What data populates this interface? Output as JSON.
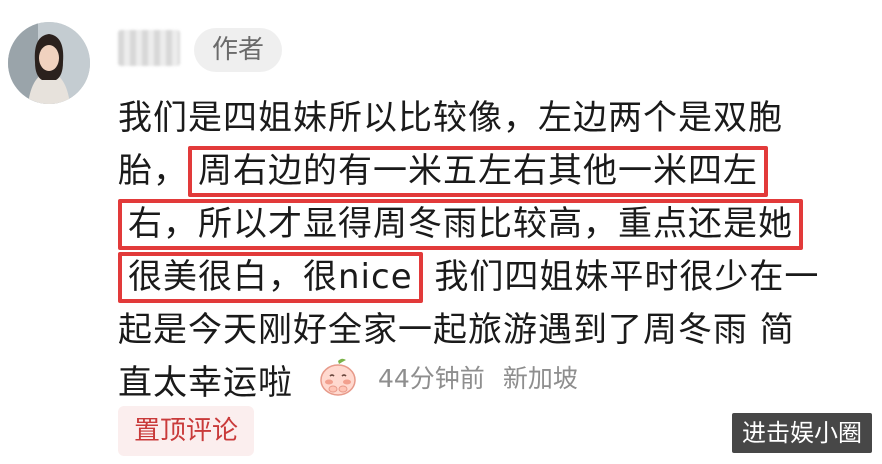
{
  "comment": {
    "author_badge": "作者",
    "lines": [
      {
        "pre": "我们是四姐妹所以比较像，左边两个是双胞",
        "hl": "",
        "post": ""
      },
      {
        "pre": "胎，",
        "hl": "周右边的有一米五左右其他一米四左",
        "post": ""
      },
      {
        "pre": "",
        "hl": "右，所以才显得周冬雨比较高，重点还是她",
        "post": ""
      },
      {
        "pre": "",
        "hl": "很美很白，很nice",
        "post": " 我们四姐妹平时很少在一"
      },
      {
        "pre": "起是今天刚好全家一起旅游遇到了周冬雨 简",
        "hl": "",
        "post": ""
      },
      {
        "pre": "直太幸运啦",
        "hl": "",
        "post": ""
      }
    ],
    "time": "44分钟前",
    "location": "新加坡",
    "pin_label": "置顶评论",
    "highlight_color": "#e23a3a"
  },
  "watermark": "进击娱小圈"
}
